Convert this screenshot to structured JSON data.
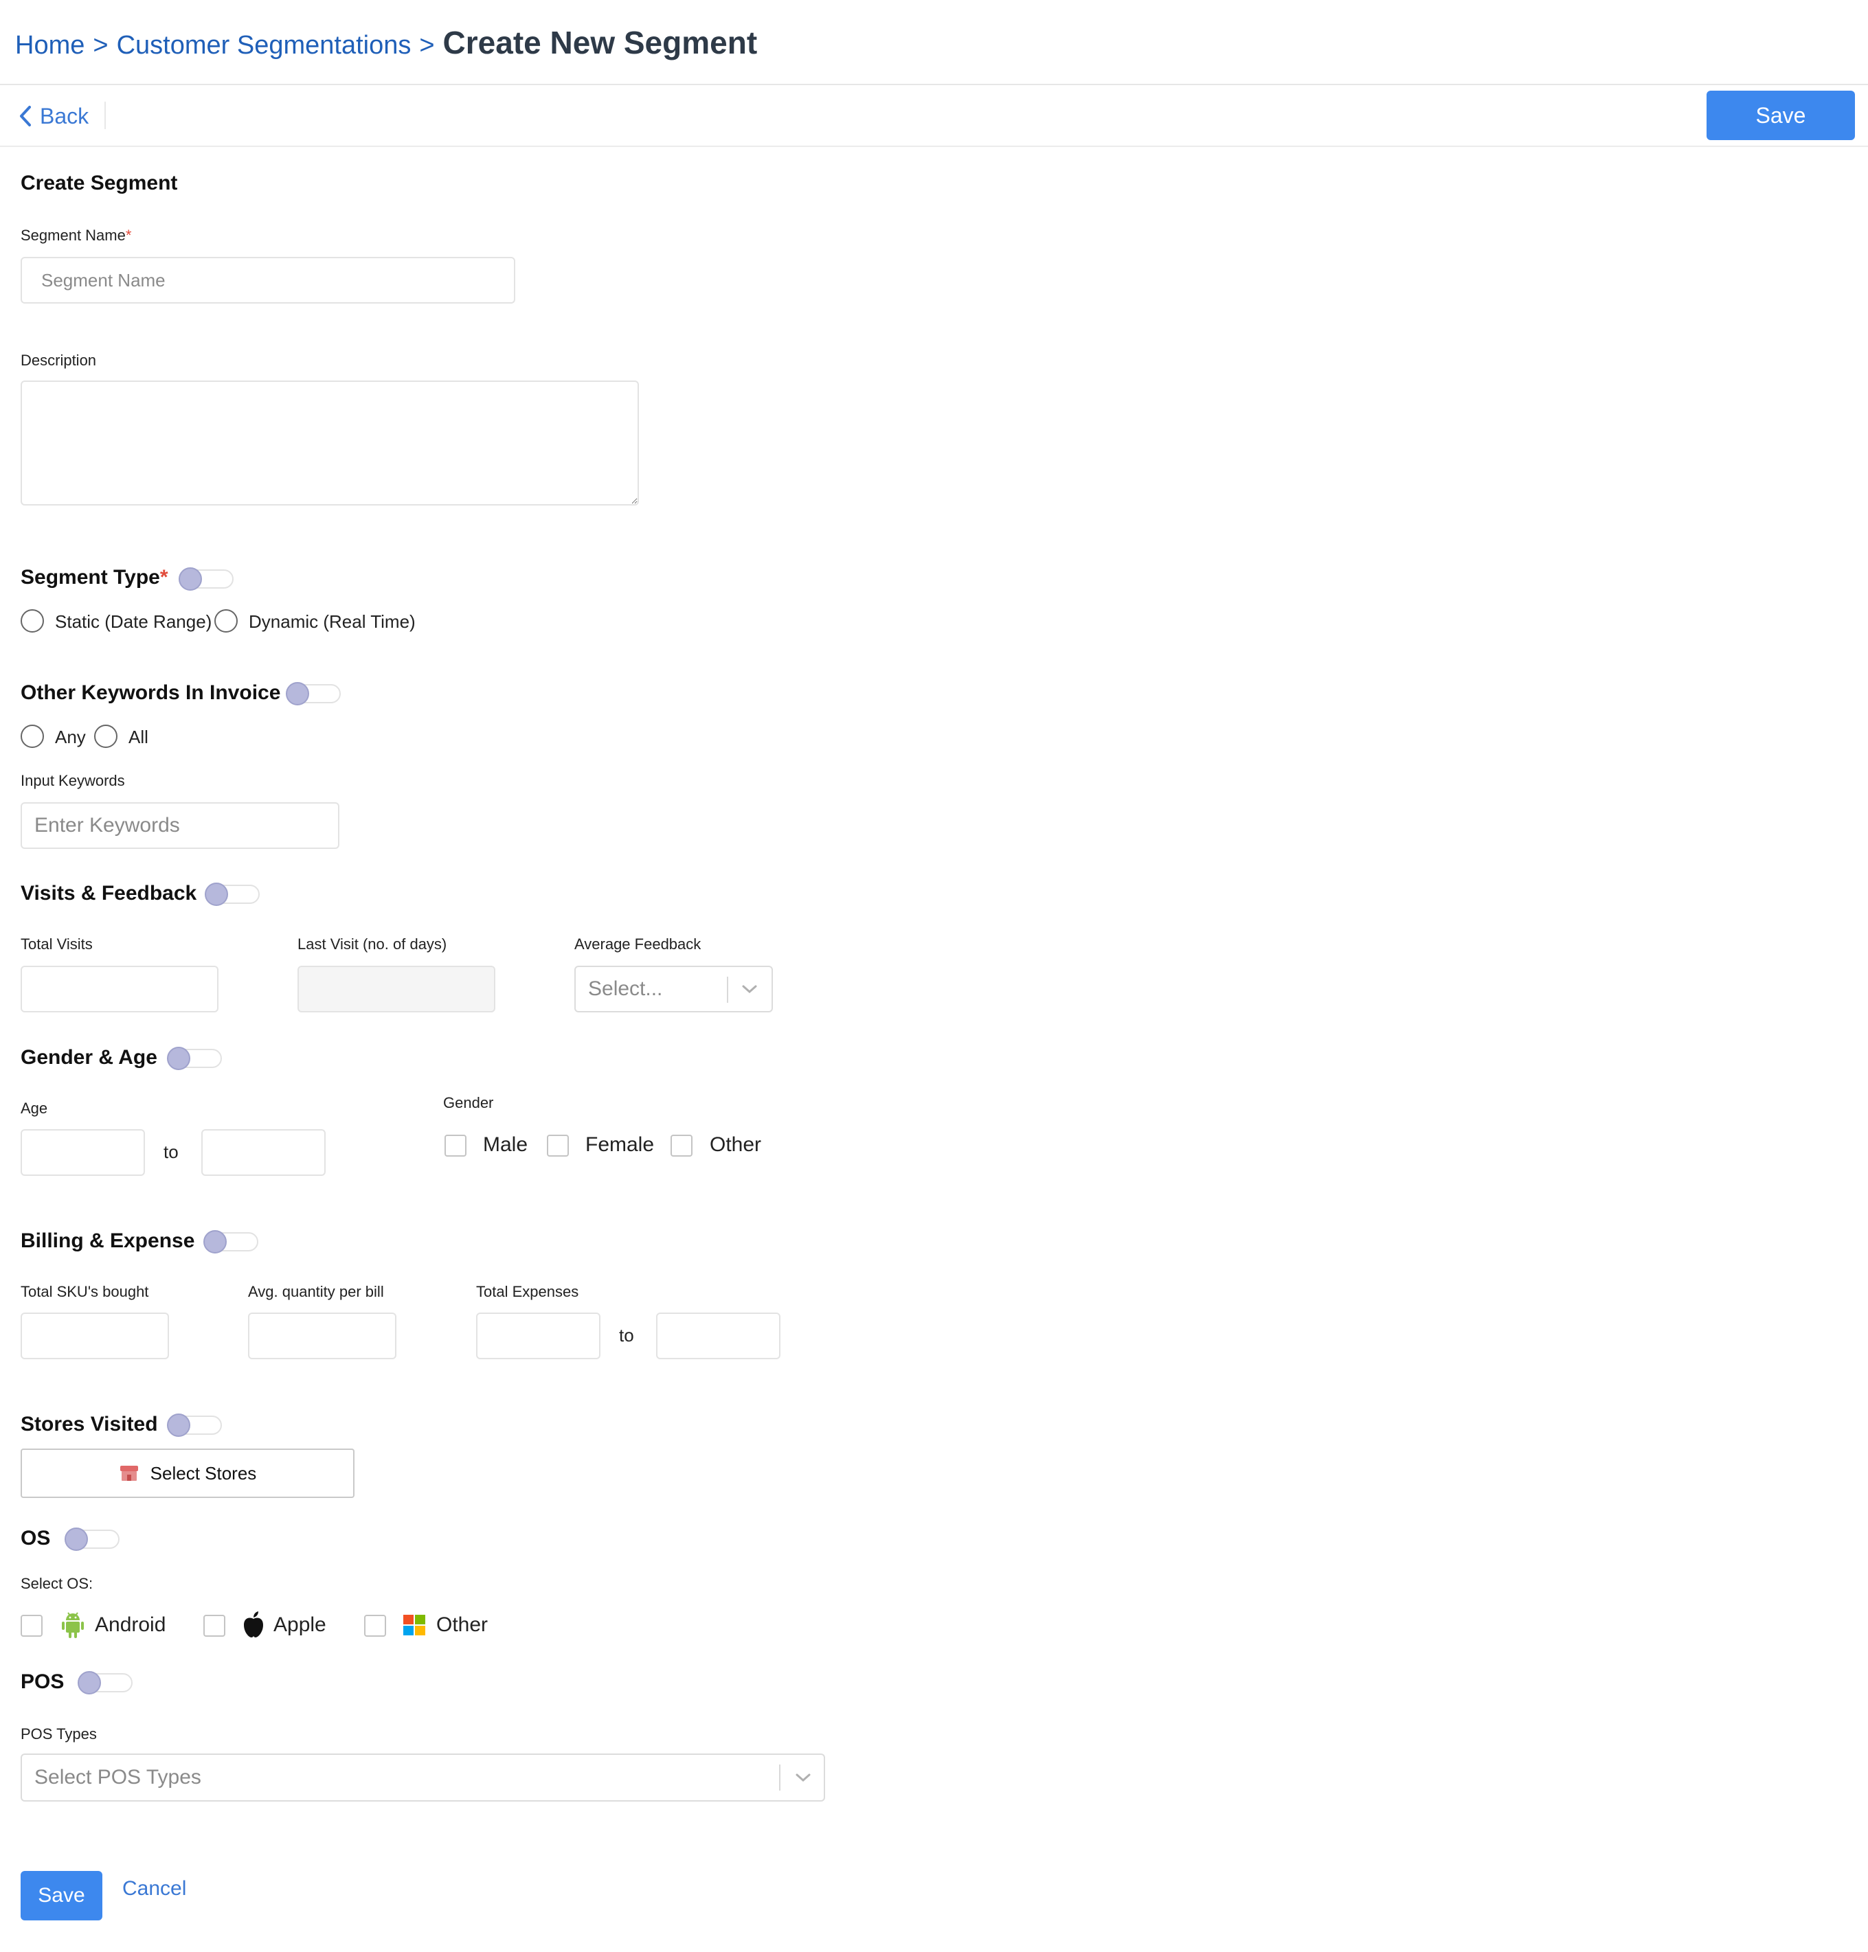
{
  "breadcrumb": {
    "home": "Home",
    "separator": ">",
    "segmentations": "Customer Segmentations",
    "current": "Create New Segment"
  },
  "toolbar": {
    "back_label": "Back",
    "save_label": "Save"
  },
  "form": {
    "title": "Create Segment",
    "segment_name": {
      "label": "Segment Name",
      "required_mark": "*",
      "placeholder": "Segment Name",
      "value": ""
    },
    "description": {
      "label": "Description",
      "value": ""
    },
    "segment_type": {
      "title": "Segment Type",
      "required_mark": "*",
      "enabled": false,
      "options": [
        "Static (Date Range)",
        "Dynamic (Real Time)"
      ]
    },
    "keywords": {
      "title": "Other Keywords In Invoice",
      "enabled": false,
      "options": [
        "Any",
        "All"
      ],
      "input_label": "Input Keywords",
      "placeholder": "Enter Keywords"
    },
    "visits": {
      "title": "Visits & Feedback",
      "enabled": false,
      "total_visits_label": "Total Visits",
      "last_visit_label": "Last Visit (no. of days)",
      "avg_feedback_label": "Average Feedback",
      "avg_feedback_placeholder": "Select..."
    },
    "gender_age": {
      "title": "Gender & Age",
      "enabled": false,
      "age_label": "Age",
      "to_label": "to",
      "gender_label": "Gender",
      "genders": [
        "Male",
        "Female",
        "Other"
      ]
    },
    "billing": {
      "title": "Billing & Expense",
      "enabled": false,
      "sku_label": "Total SKU's bought",
      "avg_qty_label": "Avg. quantity per bill",
      "expenses_label": "Total Expenses",
      "to_label": "to"
    },
    "stores": {
      "title": "Stores Visited",
      "enabled": false,
      "button_label": "Select Stores"
    },
    "os": {
      "title": "OS",
      "enabled": false,
      "select_label": "Select OS:",
      "options": [
        "Android",
        "Apple",
        "Other"
      ]
    },
    "pos": {
      "title": "POS",
      "enabled": false,
      "types_label": "POS Types",
      "placeholder": "Select POS Types"
    }
  },
  "footer": {
    "save_label": "Save",
    "cancel_label": "Cancel"
  },
  "colors": {
    "primary": "#3d88ee",
    "link": "#1f5fb8",
    "required": "#e14b3b",
    "toggle_knob": "#b6b8dc"
  }
}
